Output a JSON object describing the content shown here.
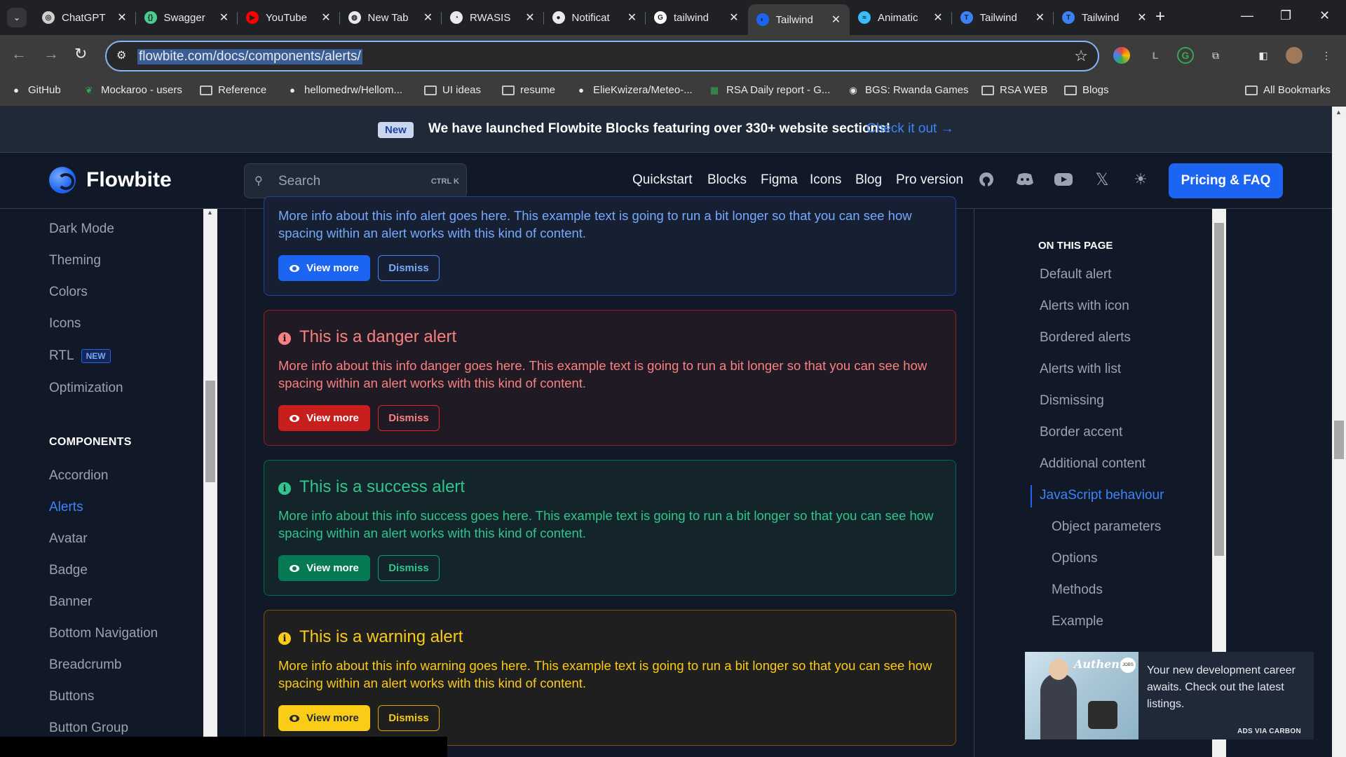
{
  "browser": {
    "tabs": [
      {
        "title": "ChatGPT",
        "fav_color": "#cfcfcf",
        "fav_glyph": "◎"
      },
      {
        "title": "Swagger",
        "fav_color": "#49cc90",
        "fav_glyph": "{}"
      },
      {
        "title": "YouTube",
        "fav_color": "#ff0000",
        "fav_glyph": "▶"
      },
      {
        "title": "New Tab",
        "fav_color": "#e8eaed",
        "fav_glyph": "◍"
      },
      {
        "title": "RWASIS",
        "fav_color": "#e8eaed",
        "fav_glyph": "◔"
      },
      {
        "title": "Notificat",
        "fav_color": "#e8eaed",
        "fav_glyph": "●"
      },
      {
        "title": "tailwind",
        "fav_color": "#ffffff",
        "fav_glyph": "G"
      },
      {
        "title": "Tailwind",
        "fav_color": "#1c64f2",
        "fav_glyph": "◐"
      },
      {
        "title": "Animatic",
        "fav_color": "#38bdf8",
        "fav_glyph": "≈"
      },
      {
        "title": "Tailwind",
        "fav_color": "#3b82f6",
        "fav_glyph": "T"
      },
      {
        "title": "Tailwind",
        "fav_color": "#3b82f6",
        "fav_glyph": "T"
      }
    ],
    "active_tab_index": 7,
    "url": "flowbite.com/docs/components/alerts/",
    "bookmarks": [
      {
        "label": "GitHub",
        "icon": "github-icon"
      },
      {
        "label": "Mockaroo - users",
        "icon": "mockaroo-icon"
      },
      {
        "label": "Reference",
        "icon": "folder-icon"
      },
      {
        "label": "hellomedrw/Hellom...",
        "icon": "github-icon"
      },
      {
        "label": "UI ideas",
        "icon": "folder-icon"
      },
      {
        "label": "resume",
        "icon": "folder-icon"
      },
      {
        "label": "ElieKwizera/Meteo-...",
        "icon": "github-icon"
      },
      {
        "label": "RSA Daily report - G...",
        "icon": "sheets-icon"
      },
      {
        "label": "BGS: Rwanda Games",
        "icon": "globe-icon"
      },
      {
        "label": "RSA WEB",
        "icon": "folder-icon"
      },
      {
        "label": "Blogs",
        "icon": "folder-icon"
      }
    ],
    "all_bookmarks": "All Bookmarks"
  },
  "banner": {
    "badge": "New",
    "message": "We have launched Flowbite Blocks featuring over 330+ website sections!",
    "link": "Check it out →"
  },
  "header": {
    "brand": "Flowbite",
    "search_placeholder": "Search",
    "search_kbd": "CTRL K",
    "nav": [
      "Quickstart",
      "Blocks",
      "Figma",
      "Icons",
      "Blog",
      "Pro version"
    ],
    "cta": "Pricing & FAQ"
  },
  "sidebar": {
    "top_items": [
      "Dark Mode",
      "Theming",
      "Colors",
      "Icons",
      "RTL",
      "Optimization"
    ],
    "rtl_badge": "NEW",
    "section_heading": "COMPONENTS",
    "components": [
      "Accordion",
      "Alerts",
      "Avatar",
      "Badge",
      "Banner",
      "Bottom Navigation",
      "Breadcrumb",
      "Buttons",
      "Button Group"
    ],
    "active": "Alerts"
  },
  "alerts": {
    "info": {
      "body": "More info about this info alert goes here. This example text is going to run a bit longer so that you can see how spacing within an alert works with this kind of content.",
      "view": "View more",
      "dismiss": "Dismiss"
    },
    "danger": {
      "title": "This is a danger alert",
      "body": "More info about this info danger goes here. This example text is going to run a bit longer so that you can see how spacing within an alert works with this kind of content.",
      "view": "View more",
      "dismiss": "Dismiss"
    },
    "success": {
      "title": "This is a success alert",
      "body": "More info about this info success goes here. This example text is going to run a bit longer so that you can see how spacing within an alert works with this kind of content.",
      "view": "View more",
      "dismiss": "Dismiss"
    },
    "warning": {
      "title": "This is a warning alert",
      "body": "More info about this info warning goes here. This example text is going to run a bit longer so that you can see how spacing within an alert works with this kind of content.",
      "view": "View more",
      "dismiss": "Dismiss"
    }
  },
  "toc": {
    "heading": "ON THIS PAGE",
    "items": [
      "Default alert",
      "Alerts with icon",
      "Bordered alerts",
      "Alerts with list",
      "Dismissing",
      "Border accent",
      "Additional content",
      "JavaScript behaviour"
    ],
    "subitems": [
      "Object parameters",
      "Options",
      "Methods",
      "Example"
    ],
    "active": "JavaScript behaviour"
  },
  "carbon_ad": {
    "brand": "Authentic",
    "brand_badge": "JOBS",
    "text": "Your new development career awaits. Check out the latest listings.",
    "via": "ADS VIA CARBON"
  },
  "colors": {
    "accent": "#1c64f2",
    "page_bg": "#111827",
    "danger": "#f98080",
    "success": "#31c48d",
    "warning": "#faca15",
    "info": "#76a9fa"
  }
}
